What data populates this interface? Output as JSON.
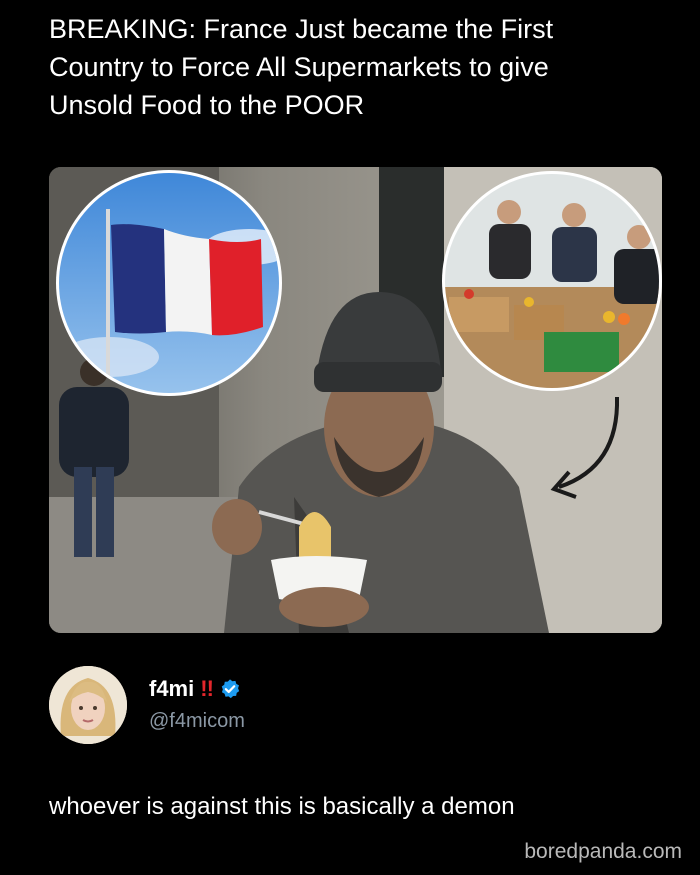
{
  "headline": {
    "line1": "BREAKING: France Just became the First",
    "line2": "Country to Force All Supermarkets to give",
    "line3": "Unsold Food to the POOR"
  },
  "media": {
    "icon": "photo-illustration",
    "alt_subjects": [
      "french-flag",
      "food-bank-volunteers",
      "man-eating-noodles"
    ]
  },
  "author": {
    "display_name": "f4mi",
    "alert": "!!",
    "handle": "@f4micom",
    "verified_icon": "verified-badge-icon",
    "verified_color": "#1d9bf0"
  },
  "tweet": {
    "text": "whoever is against this is basically a demon"
  },
  "watermark": "boredpanda.com"
}
